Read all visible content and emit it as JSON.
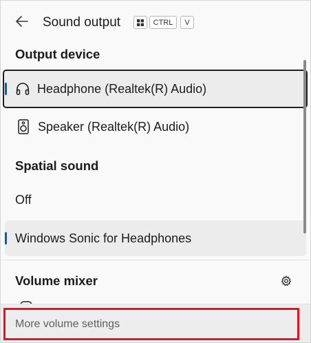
{
  "header": {
    "title": "Sound output",
    "back_icon": "back-arrow-icon",
    "shortcut_keys": [
      "win-key-icon",
      "CTRL",
      "V"
    ],
    "key_ctrl": "CTRL",
    "key_v": "V"
  },
  "output": {
    "heading": "Output device",
    "devices": [
      {
        "label": "Headphone (Realtek(R) Audio)",
        "icon": "headphone-icon",
        "selected": true
      },
      {
        "label": "Speaker (Realtek(R) Audio)",
        "icon": "speaker-icon",
        "selected": false
      }
    ]
  },
  "spatial": {
    "heading": "Spatial sound",
    "options": [
      {
        "label": "Off",
        "selected": false
      },
      {
        "label": "Windows Sonic for Headphones",
        "selected": true
      }
    ]
  },
  "mixer": {
    "heading": "Volume mixer",
    "settings_icon": "gear-icon"
  },
  "footer": {
    "link": "More volume settings"
  },
  "colors": {
    "accent": "#005fb8",
    "highlight_box": "#e81123",
    "selected_bg": "#ececec"
  }
}
